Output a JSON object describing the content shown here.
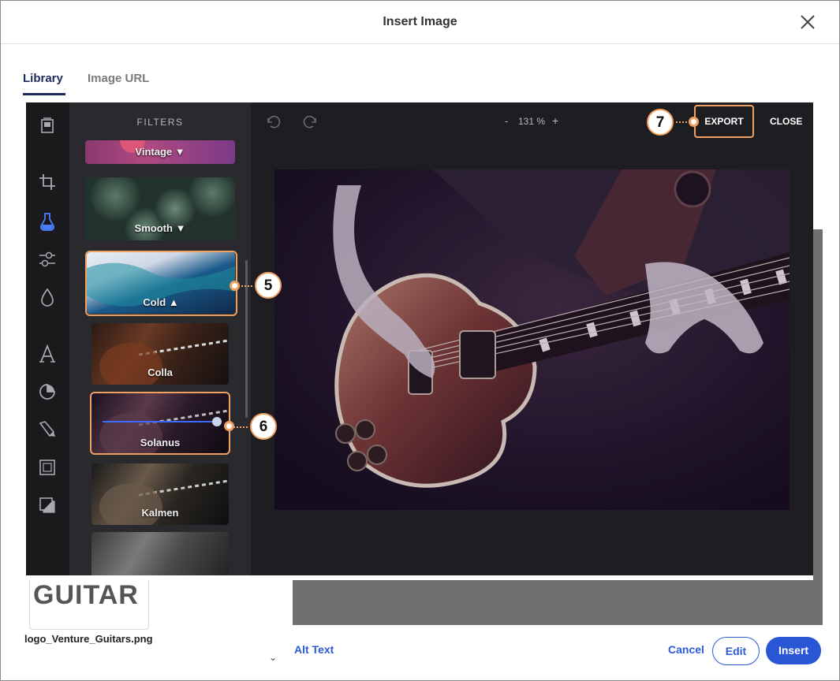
{
  "dialog": {
    "title": "Insert Image",
    "close_icon": "close-icon",
    "tabs": [
      {
        "label": "Library",
        "active": true
      },
      {
        "label": "Image URL",
        "active": false
      }
    ],
    "thumbnail_text": "GUITAR",
    "filename": "logo_Venture_Guitars.png",
    "alt_text_label": "Alt Text",
    "cancel_label": "Cancel",
    "edit_label": "Edit",
    "insert_label": "Insert",
    "accent": "#2856d4"
  },
  "editor": {
    "panel_title": "FILTERS",
    "zoom": {
      "minus": "-",
      "level": "131 %",
      "plus": "+"
    },
    "export_label": "EXPORT",
    "close_label": "CLOSE",
    "tools": [
      "frame-icon",
      "crop-icon",
      "filter-flask-icon",
      "adjust-sliders-icon",
      "drop-icon",
      "text-icon",
      "sticker-icon",
      "brush-icon",
      "overlay-frame-icon",
      "border-icon"
    ],
    "active_tool": "filter-flask-icon",
    "filters": [
      {
        "label": "Vintage",
        "indicator": "▼"
      },
      {
        "label": "Smooth",
        "indicator": "▼"
      },
      {
        "label": "Cold",
        "indicator": "▲"
      },
      {
        "label": "Colla"
      },
      {
        "label": "Solanus"
      },
      {
        "label": "Kalmen"
      }
    ],
    "highlight_color": "#f0a060"
  },
  "callouts": [
    "5",
    "6",
    "7"
  ]
}
